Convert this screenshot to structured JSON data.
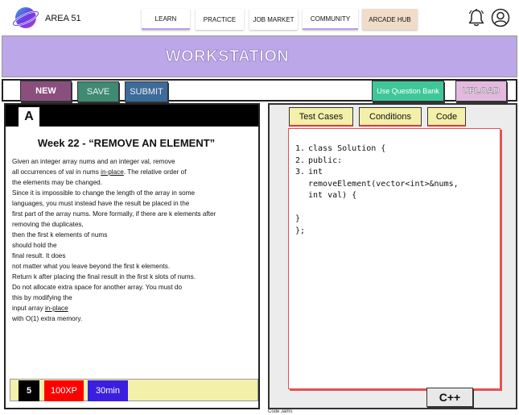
{
  "nav": {
    "brand": "AREA 51",
    "links": {
      "learn": "LEARN",
      "practice": "PRACTICE",
      "jobs": "JOB MARKET",
      "community": "COMMUNITY",
      "arcade": "ARCADE HUB"
    }
  },
  "banner": {
    "title": "WORKSTATION"
  },
  "toolbar": {
    "new": "NEW",
    "save": "SAVE",
    "submit": "SUBMIT",
    "question_bank": "Use Question Bank",
    "upload": "UPLOAD"
  },
  "problem": {
    "level": "A",
    "title": "Week 22 - “REMOVE AN ELEMENT”",
    "lines": {
      "l1": "Given an integer array nums and an integer val, remove",
      "l2a": " all occurrences of val in nums ",
      "l2b": "in-place",
      "l2c": ". The relative order of",
      "l3": " the elements may be changed.",
      "l4": "Since it is impossible to change the length of the array in some",
      "l5": " languages, you must instead have the result be placed in the",
      "l6": "first part of the array nums. More formally, if there are k elements after",
      "l7": " removing the duplicates,",
      "l8": "then the first k elements of nums",
      "l9": " should hold the",
      "l10": "final result. It does",
      "l11": "not matter what you leave beyond the first k elements.",
      "l12": "Return k after placing the final result in the first k slots of nums.",
      "l13": "Do not allocate extra space for another array. You must do",
      "l14": "this by modifying the",
      "l15a": "input array ",
      "l15b": "in-place",
      "l16": "with O(1) extra memory."
    },
    "footer": {
      "number": "5",
      "xp": "100XP",
      "time": "30min"
    }
  },
  "editor": {
    "tabs": {
      "tests": "Test Cases",
      "conditions": "Conditions",
      "code": "Code"
    },
    "code": {
      "n1": "1.",
      "c1": "class Solution {",
      "n2": "2.",
      "c2": "public:",
      "n3": "3.",
      "c3": "int",
      "c4": "removeElement(vector<int>&nums,",
      "c5": "int val) {",
      "c6": "}",
      "c7": "};"
    },
    "language": "C++",
    "caption": "Code Jams"
  },
  "colors": {
    "banner": "#bca7e8",
    "new_button": "#8a4f7d",
    "save_button": "#3f8a73",
    "submit_button": "#3d6b9a",
    "question_bank_button": "#3fc79a",
    "upload_button": "#e4b9e0",
    "xp_badge": "#ff0000",
    "time_badge": "#3a1fe0",
    "tab_bg": "#f3f0a9"
  }
}
